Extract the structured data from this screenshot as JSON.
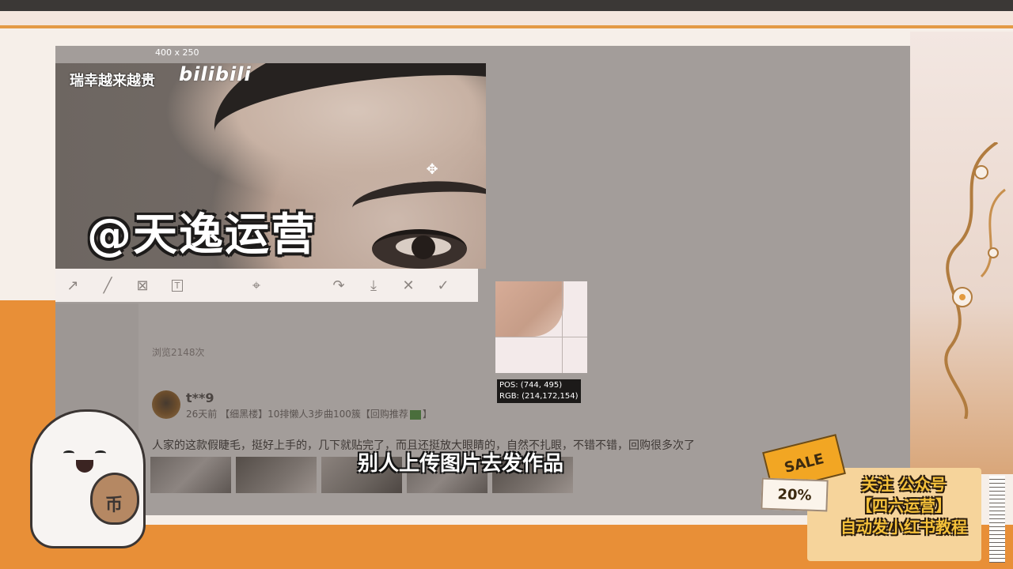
{
  "capture": {
    "size_label": "400 x 250",
    "channel_watermark": "瑞幸越来越贵",
    "bili_logo": "bilibili",
    "big_watermark": "@天逸运营"
  },
  "toolbar": {
    "tools": [
      {
        "name": "arrow-tool",
        "glyph": "↗"
      },
      {
        "name": "pen-tool",
        "glyph": "╱"
      },
      {
        "name": "mosaic-tool",
        "glyph": "⊠"
      },
      {
        "name": "text-tool",
        "glyph": "T"
      },
      {
        "name": "ocr-tool",
        "glyph": "⌖"
      },
      {
        "name": "share-tool",
        "glyph": "↷"
      },
      {
        "name": "save-tool",
        "glyph": "⤓"
      },
      {
        "name": "cancel-tool",
        "glyph": "✕"
      },
      {
        "name": "confirm-tool",
        "glyph": "✓"
      }
    ]
  },
  "post": {
    "views": "浏览2148次",
    "username": "t**9",
    "meta_prefix": "26天前 【细黑楼】10排懒人3步曲100簇【回购推荐",
    "meta_suffix": "】",
    "review": "人家的这款假睫毛，挺好上手的，几下就贴完了，而且还挺放大眼睛的，自然不扎眼，不错不错，回购很多次了"
  },
  "magnifier": {
    "pos": "POS: (744, 495)",
    "rgb": "RGB: (214,172,154)"
  },
  "subtitle": "别人上传图片去发作品",
  "promo": {
    "sale": "SALE",
    "percent": "20%",
    "line1": "关注 公众号",
    "line2": "【四六运营】",
    "line3": "自动发小红书教程"
  },
  "mascot": {
    "coin_glyph": "币"
  }
}
